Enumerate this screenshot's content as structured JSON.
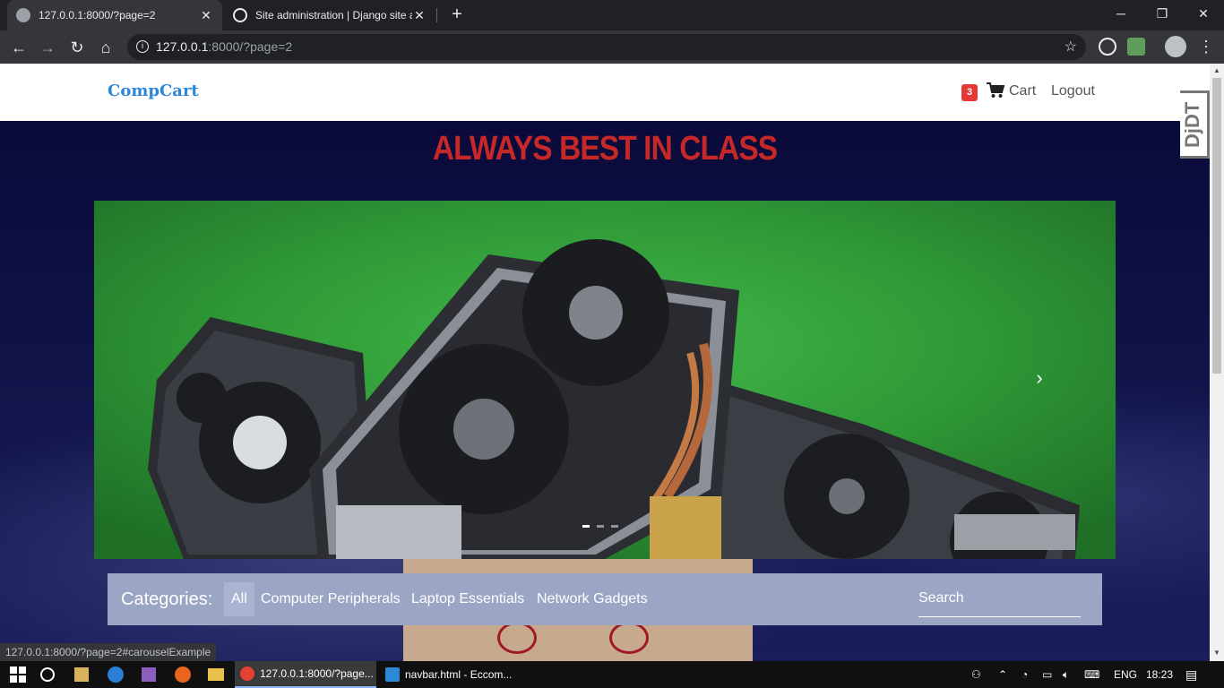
{
  "browser": {
    "tabs": [
      {
        "title": "127.0.0.1:8000/?page=2",
        "active": true
      },
      {
        "title": "Site administration | Django site admin",
        "active": false
      }
    ],
    "address": {
      "host": "127.0.0.1",
      "path": ":8000/?page=2"
    },
    "status_url": "127.0.0.1:8000/?page=2#carouselExample",
    "window_controls": {
      "minimize": "─",
      "restore": "❐",
      "close": "✕"
    }
  },
  "site": {
    "brand": "CompCart",
    "cart_count": "3",
    "cart_label": "Cart",
    "logout_label": "Logout",
    "debug_toolbar_label": "DjDT",
    "headline": "ALWAYS BEST IN CLASS",
    "carousel": {
      "next_icon": "›",
      "slide_count": 3,
      "active_slide": 1
    },
    "categories": {
      "label": "Categories:",
      "items": [
        "All",
        "Computer Peripherals",
        "Laptop Essentials",
        "Network Gadgets"
      ],
      "active": "All",
      "search_placeholder": "Search"
    }
  },
  "taskbar": {
    "apps": [
      {
        "title": "127.0.0.1:8000/?page...",
        "active": true
      },
      {
        "title": "navbar.html - Eccom...",
        "active": false
      }
    ],
    "language": "ENG",
    "time": "18:23"
  },
  "colors": {
    "brand": "#2d87d9",
    "headline": "#c62828",
    "badge": "#e53935",
    "category_bar": "#9ba6c5"
  }
}
